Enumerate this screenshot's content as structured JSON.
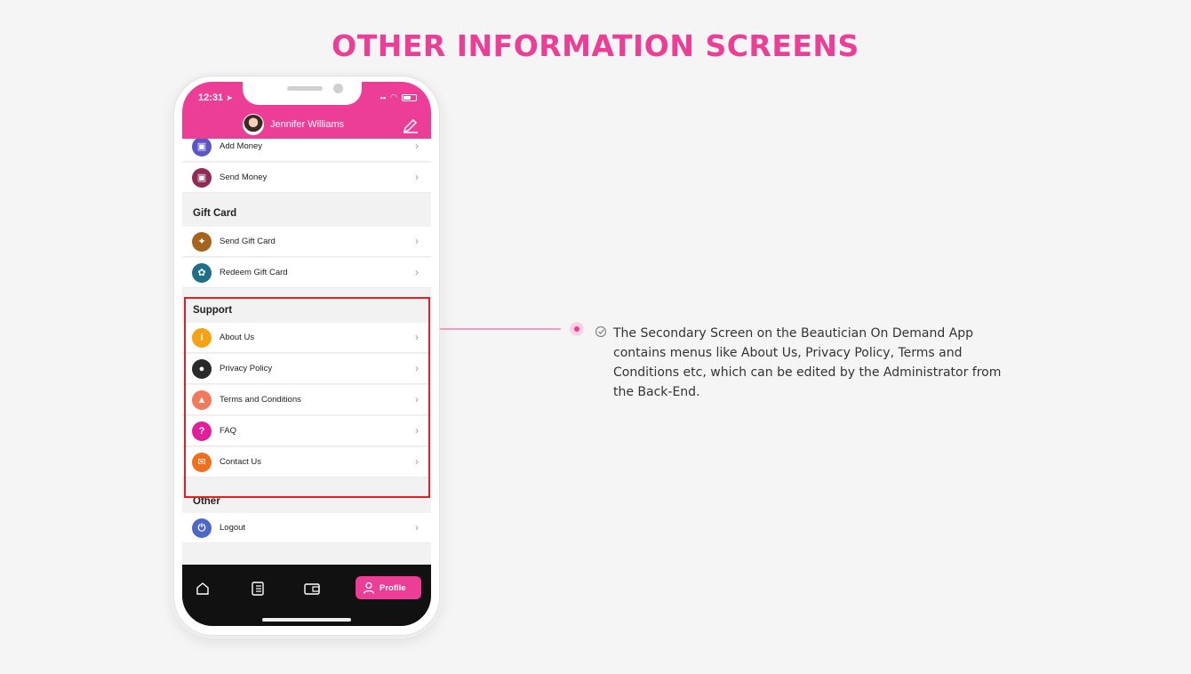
{
  "heading": "OTHER INFORMATION SCREENS",
  "status_bar": {
    "time": "12:31",
    "arrow": "➤"
  },
  "header": {
    "user_name": "Jennifer Williams"
  },
  "rows": {
    "add_money": "Add Money",
    "send_money": "Send Money",
    "send_gift_card": "Send Gift Card",
    "redeem_gift_card": "Redeem Gift Card",
    "about_us": "About Us",
    "privacy_policy": "Privacy Policy",
    "terms": "Terms and Conditions",
    "faq": "FAQ",
    "contact_us": "Contact Us",
    "logout": "Logout"
  },
  "sections": {
    "gift_card": "Gift Card",
    "support": "Support",
    "other": "Other"
  },
  "tab_bar": {
    "profile_label": "Profile"
  },
  "description": "The Secondary Screen on the Beautician On Demand App contains menus like About Us, Privacy Policy, Terms and Conditions etc, which can be edited by the Administrator from the Back-End.",
  "colors": {
    "brand": "#ec3d97",
    "highlight": "#e31e24"
  },
  "icons": {
    "add_money": "wallet-plus-icon",
    "send_money": "wallet-send-icon",
    "send_gift_card": "gift-icon",
    "redeem_gift_card": "gift-redeem-icon",
    "about_us": "info-icon",
    "privacy_policy": "lock-icon",
    "terms": "padlock-icon",
    "faq": "question-icon",
    "contact_us": "mail-icon",
    "logout": "power-icon"
  }
}
